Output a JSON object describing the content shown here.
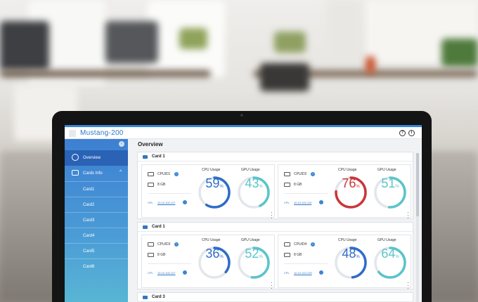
{
  "app": {
    "title": "Mustang-200"
  },
  "header_icons": [
    "help-icon",
    "info-icon"
  ],
  "sidebar": {
    "overview_label": "Overview",
    "cards_info_label": "Cards Info",
    "cards": [
      "Card1",
      "Card2",
      "Card3",
      "Card4",
      "Card5",
      "Card6"
    ]
  },
  "main": {
    "title": "Overview",
    "cpu_label": "CPU Usage",
    "gpu_label": "GPU Usage",
    "panels": [
      {
        "title": "Card 1",
        "gpus": [
          {
            "name": "CPUID1",
            "mem": "8 GB",
            "cpl": "CPL",
            "ip": "10.10.102.117",
            "cpu": 59,
            "gpu": 43,
            "cpu_color": "#2f6cc7",
            "gpu_color": "#5bc4c9"
          },
          {
            "name": "CPUID2",
            "mem": "8 GB",
            "cpl": "CPL",
            "ip": "10.10.102.119",
            "cpu": 76,
            "gpu": 51,
            "cpu_color": "#c9373a",
            "gpu_color": "#5bc4c9"
          }
        ]
      },
      {
        "title": "Card 1",
        "gpus": [
          {
            "name": "CPUID3",
            "mem": "8 GB",
            "cpl": "CPL",
            "ip": "10.10.102.127",
            "cpu": 36,
            "gpu": 52,
            "cpu_color": "#2f6cc7",
            "gpu_color": "#5bc4c9"
          },
          {
            "name": "CPUID4",
            "mem": "8 GB",
            "cpl": "CPL",
            "ip": "10.10.102.129",
            "cpu": 48,
            "gpu": 64,
            "cpu_color": "#2f6cc7",
            "gpu_color": "#5bc4c9"
          }
        ]
      },
      {
        "title": "Card 3",
        "gpus": []
      }
    ],
    "percent_sign": "%"
  }
}
